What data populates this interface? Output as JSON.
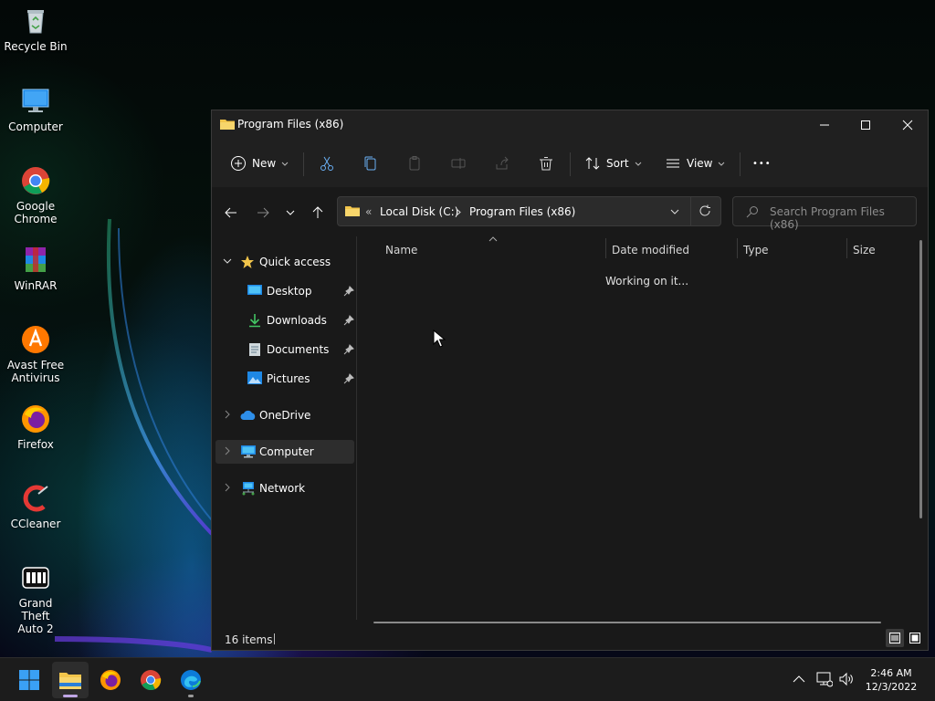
{
  "desktop": {
    "icons": [
      {
        "label_line1": "Recycle Bin",
        "label_line2": ""
      },
      {
        "label_line1": "Computer",
        "label_line2": ""
      },
      {
        "label_line1": "Google",
        "label_line2": "Chrome"
      },
      {
        "label_line1": "WinRAR",
        "label_line2": ""
      },
      {
        "label_line1": "Avast Free",
        "label_line2": "Antivirus"
      },
      {
        "label_line1": "Firefox",
        "label_line2": ""
      },
      {
        "label_line1": "CCleaner",
        "label_line2": ""
      },
      {
        "label_line1": "Grand Theft",
        "label_line2": "Auto 2"
      }
    ]
  },
  "window": {
    "title": "Program Files (x86)",
    "toolbar": {
      "new_label": "New",
      "sort_label": "Sort",
      "view_label": "View",
      "more_label": "•••"
    },
    "address": {
      "overflow": "«",
      "crumbs": [
        "Local Disk (C:)",
        "Program Files (x86)"
      ]
    },
    "search": {
      "placeholder": "Search Program Files (x86)"
    },
    "nav": {
      "quick_access": "Quick access",
      "items": [
        "Desktop",
        "Downloads",
        "Documents",
        "Pictures"
      ],
      "onedrive": "OneDrive",
      "computer": "Computer",
      "network": "Network"
    },
    "columns": [
      "Name",
      "Date modified",
      "Type",
      "Size"
    ],
    "loading_text": "Working on it...",
    "status": {
      "item_count": "16 items"
    }
  },
  "taskbar": {
    "time": "2:46 AM",
    "date": "12/3/2022"
  },
  "colors": {
    "accent": "#0078d4",
    "folder": "#f2c54b",
    "window_bg": "#191919",
    "chrome_bg": "#202020"
  }
}
